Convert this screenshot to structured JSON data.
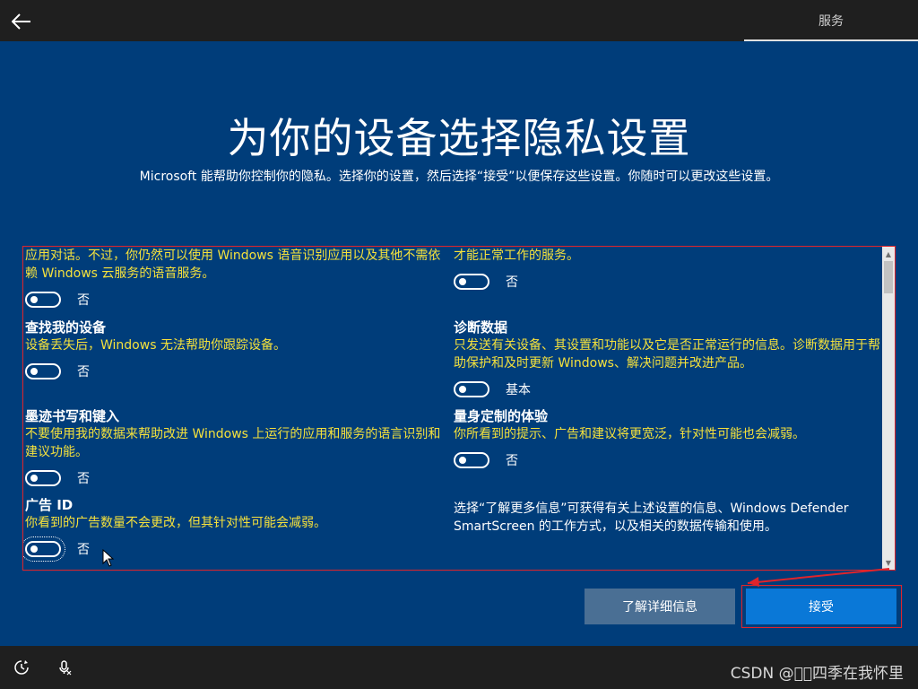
{
  "header": {
    "back_icon": "back-arrow-icon",
    "tab_label": "服务"
  },
  "page": {
    "title": "为你的设备选择隐私设置",
    "subtitle": "Microsoft 能帮助你控制你的隐私。选择你的设置，然后选择“接受”以便保存这些设置。你随时可以更改这些设置。"
  },
  "settings": {
    "left": [
      {
        "title": "",
        "desc": "应用对话。不过，你仍然可以使用 Windows 语音识别应用以及其他不需依赖 Windows 云服务的语音服务。",
        "state": "否"
      },
      {
        "title": "查找我的设备",
        "desc": "设备丢失后，Windows 无法帮助你跟踪设备。",
        "state": "否"
      },
      {
        "title": "墨迹书写和键入",
        "desc": "不要使用我的数据来帮助改进 Windows 上运行的应用和服务的语言识别和建议功能。",
        "state": "否"
      },
      {
        "title": "广告 ID",
        "desc": "你看到的广告数量不会更改，但其针对性可能会减弱。",
        "state": "否"
      }
    ],
    "right": [
      {
        "title": "",
        "desc": "才能正常工作的服务。",
        "state": "否"
      },
      {
        "title": "诊断数据",
        "desc": "只发送有关设备、其设置和功能以及它是否正常运行的信息。诊断数据用于帮助保护和及时更新 Windows、解决问题并改进产品。",
        "state": "基本"
      },
      {
        "title": "量身定制的体验",
        "desc": "你所看到的提示、广告和建议将更宽泛，针对性可能也会减弱。",
        "state": "否"
      }
    ],
    "info": "选择“了解更多信息”可获得有关上述设置的信息、Windows Defender SmartScreen 的工作方式，以及相关的数据传输和使用。"
  },
  "buttons": {
    "learn_more": "了解详细信息",
    "accept": "接受"
  },
  "footer": {
    "left_icons": [
      "ease-of-access-icon",
      "microphone-icon"
    ],
    "watermark": "CSDN @\u0000\u0000四季在我怀里"
  },
  "colors": {
    "background": "#003d7a",
    "desc_text": "#f5e13c",
    "accent_button": "#0a78d7",
    "secondary_button": "#4a6f94",
    "annotation": "#e0242b"
  }
}
